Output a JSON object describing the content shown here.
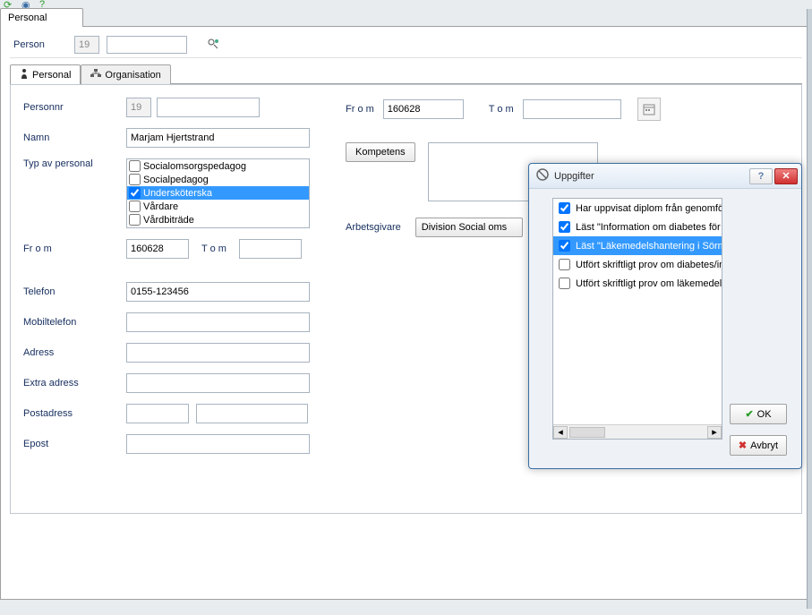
{
  "main_tab": "Personal",
  "person_bar": {
    "label": "Person",
    "prefix": "19",
    "value": ""
  },
  "sub_tabs": {
    "personal": "Personal",
    "organisation": "Organisation"
  },
  "form": {
    "personnr_label": "Personnr",
    "personnr_prefix": "19",
    "personnr_value": "",
    "namn_label": "Namn",
    "namn_value": "Marjam Hjertstrand",
    "typ_label": "Typ av personal",
    "typ_options": [
      {
        "label": "Socialomsorgspedagog",
        "checked": false,
        "selected": false
      },
      {
        "label": "Socialpedagog",
        "checked": false,
        "selected": false
      },
      {
        "label": "Undersköterska",
        "checked": true,
        "selected": true
      },
      {
        "label": "Vårdare",
        "checked": false,
        "selected": false
      },
      {
        "label": "Vårdbiträde",
        "checked": false,
        "selected": false
      }
    ],
    "from_label": "Fr o m",
    "from_value": "160628",
    "tom_label": "T o m",
    "tom_value": "",
    "telefon_label": "Telefon",
    "telefon_value": "0155-123456",
    "mobil_label": "Mobiltelefon",
    "mobil_value": "",
    "adress_label": "Adress",
    "adress_value": "",
    "extra_label": "Extra adress",
    "extra_value": "",
    "post_label": "Postadress",
    "post_value1": "",
    "post_value2": "",
    "epost_label": "Epost",
    "epost_value": ""
  },
  "right": {
    "from_label": "Fr o m",
    "from_value": "160628",
    "tom_label": "T o m",
    "tom_value": "",
    "kompetens_button": "Kompetens",
    "arbetsgivare_label": "Arbetsgivare",
    "arbetsgivare_value": "Division Social oms"
  },
  "dialog": {
    "title": "Uppgifter",
    "items": [
      {
        "label": "Har uppvisat diplom från genomförd",
        "checked": true,
        "selected": false
      },
      {
        "label": "Läst \"Information om diabetes för vå",
        "checked": true,
        "selected": false
      },
      {
        "label": "Läst \"Läkemedelshantering i Sörmla",
        "checked": true,
        "selected": true
      },
      {
        "label": "Utfört skriftligt prov om diabetes/insu",
        "checked": false,
        "selected": false
      },
      {
        "label": "Utfört skriftligt prov om läkemedelsha",
        "checked": false,
        "selected": false
      }
    ],
    "ok": "OK",
    "cancel": "Avbryt"
  }
}
